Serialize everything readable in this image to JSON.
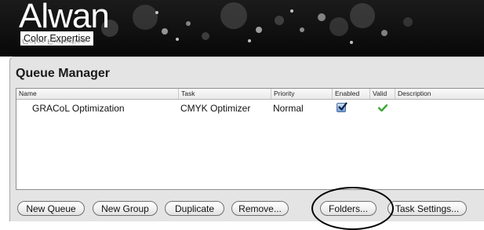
{
  "banner": {
    "logo_word": "Alwan",
    "logo_tagline": "Color Expertise"
  },
  "window": {
    "title": "Queue Manager"
  },
  "table": {
    "columns": [
      "Name",
      "Task",
      "Priority",
      "Enabled",
      "Valid",
      "Description"
    ],
    "rows": [
      {
        "name": "GRACoL Optimization",
        "task": "CMYK Optimizer",
        "priority": "Normal",
        "enabled": true,
        "valid": true,
        "description": ""
      }
    ]
  },
  "buttons": {
    "new_queue": "New Queue",
    "new_group": "New Group",
    "duplicate": "Duplicate",
    "remove": "Remove...",
    "folders": "Folders...",
    "task_settings": "Task Settings..."
  },
  "icons": {
    "enabled_checkbox": "checkbox-checked-icon",
    "valid_mark": "green-checkmark-icon"
  },
  "colors": {
    "valid_green": "#3aa832",
    "checkbox_blue": "#6d9edb",
    "banner_black": "#0b0b0b"
  }
}
